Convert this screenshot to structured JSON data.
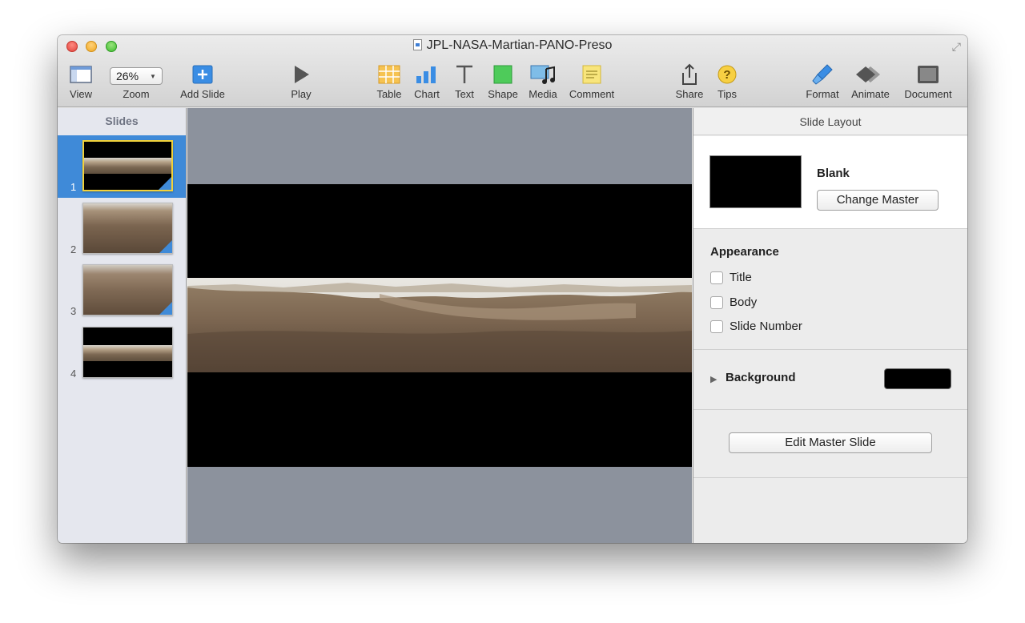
{
  "window": {
    "title": "JPL-NASA-Martian-PANO-Preso"
  },
  "toolbar": {
    "view": "View",
    "zoom_value": "26%",
    "zoom": "Zoom",
    "add_slide": "Add Slide",
    "play": "Play",
    "table": "Table",
    "chart": "Chart",
    "text": "Text",
    "shape": "Shape",
    "media": "Media",
    "comment": "Comment",
    "share": "Share",
    "tips": "Tips",
    "format": "Format",
    "animate": "Animate",
    "document": "Document"
  },
  "sidebar": {
    "title": "Slides",
    "slides": [
      {
        "number": "1",
        "selected": true
      },
      {
        "number": "2",
        "selected": false
      },
      {
        "number": "3",
        "selected": false
      },
      {
        "number": "4",
        "selected": false
      }
    ]
  },
  "inspector": {
    "title": "Slide Layout",
    "master_name": "Blank",
    "change_master": "Change Master",
    "appearance": {
      "heading": "Appearance",
      "options": [
        {
          "label": "Title",
          "checked": false
        },
        {
          "label": "Body",
          "checked": false
        },
        {
          "label": "Slide Number",
          "checked": false
        }
      ]
    },
    "background_label": "Background",
    "background_color": "#000000",
    "edit_master": "Edit Master Slide"
  },
  "colors": {
    "selection": "#3f8ad8",
    "selection_border": "#f3d23a",
    "canvas": "#8c929d"
  }
}
